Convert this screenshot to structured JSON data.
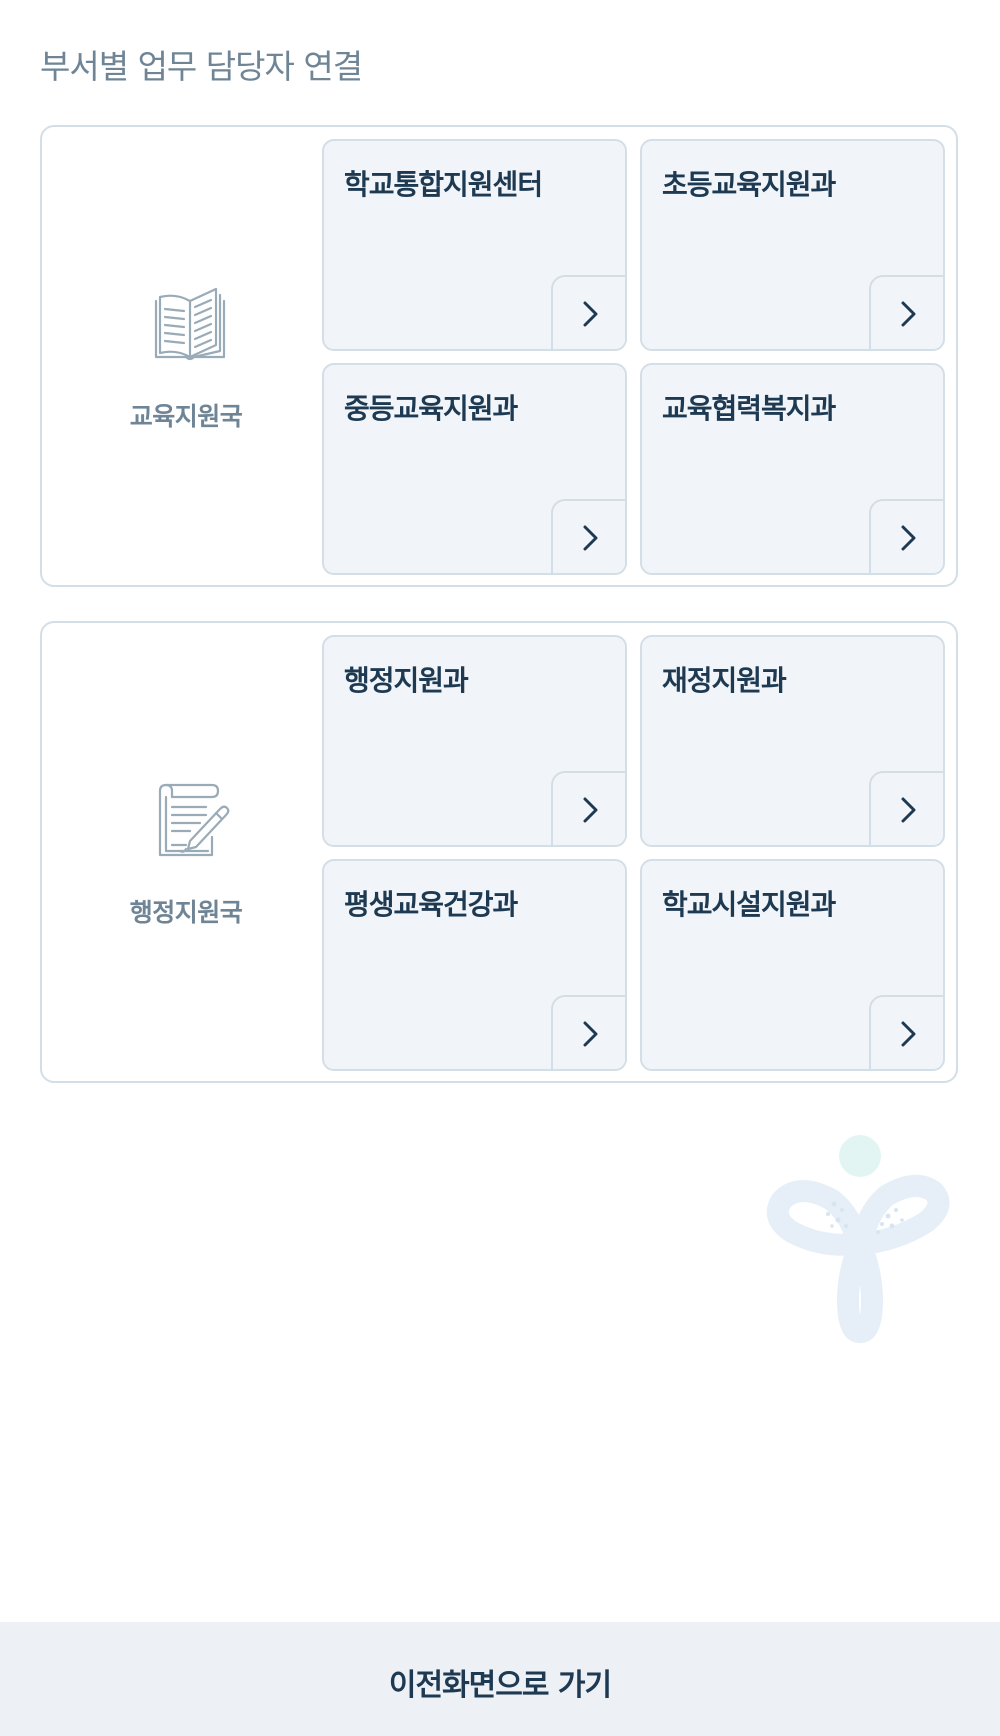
{
  "header": {
    "title": "부서별 업무 담당자 연결"
  },
  "groups": [
    {
      "name": "교육지원국",
      "icon": "open-book-icon",
      "departments": [
        {
          "label": "학교통합지원센터",
          "arrow_icon": "chevron-right-icon"
        },
        {
          "label": "초등교육지원과",
          "arrow_icon": "chevron-right-icon"
        },
        {
          "label": "중등교육지원과",
          "arrow_icon": "chevron-right-icon"
        },
        {
          "label": "교육협력복지과",
          "arrow_icon": "chevron-right-icon"
        }
      ]
    },
    {
      "name": "행정지원국",
      "icon": "document-pen-icon",
      "departments": [
        {
          "label": "행정지원과",
          "arrow_icon": "chevron-right-icon"
        },
        {
          "label": "재정지원과",
          "arrow_icon": "chevron-right-icon"
        },
        {
          "label": "평생교육건강과",
          "arrow_icon": "chevron-right-icon"
        },
        {
          "label": "학교시설지원과",
          "arrow_icon": "chevron-right-icon"
        }
      ]
    }
  ],
  "decoration": {
    "mascot_icon": "mascot-logo-icon"
  },
  "footer": {
    "back_label": "이전화면으로 가기"
  },
  "colors": {
    "title_gray": "#6f8596",
    "navy": "#1e3a52",
    "card_bg": "#f1f5f9",
    "border": "#d4dee6",
    "footer_bg": "#edf1f5"
  }
}
